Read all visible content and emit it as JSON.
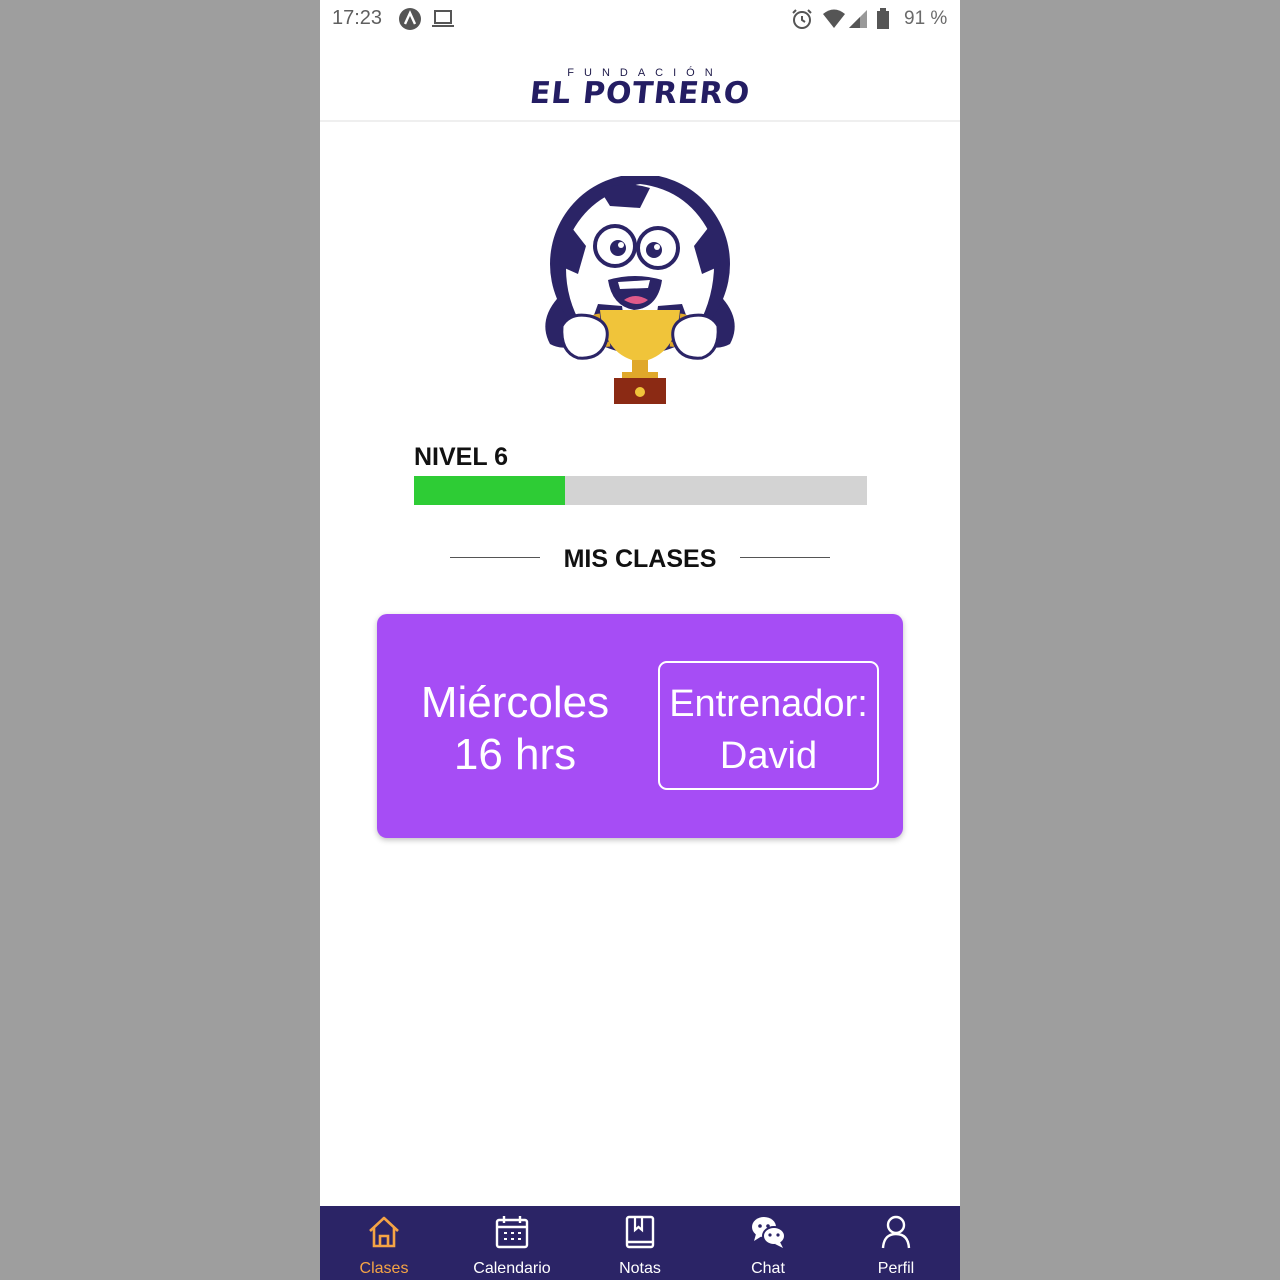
{
  "status_bar": {
    "time": "17:23",
    "battery_text": "91 %",
    "icons": [
      "app-notification-icon",
      "laptop-icon",
      "alarm-icon",
      "wifi-icon",
      "signal-icon",
      "battery-icon"
    ]
  },
  "header": {
    "brand_sub": "FUNDACIÓN",
    "brand_main": "EL POTRERO"
  },
  "mascot": {
    "icon": "soccer-ball-trophy-mascot"
  },
  "level": {
    "title": "NIVEL 6",
    "progress": 0.333,
    "fill_color": "#2ecc35",
    "track_color": "#d3d3d3"
  },
  "section": {
    "title": "MIS CLASES"
  },
  "class_card": {
    "day": "Miércoles",
    "time": "16 hrs",
    "coach_label": "Entrenador:",
    "coach_name": "David",
    "color": "#a64df5"
  },
  "bottom_nav": {
    "items": [
      {
        "label": "Clases",
        "icon": "home-icon",
        "active": true
      },
      {
        "label": "Calendario",
        "icon": "calendar-icon",
        "active": false
      },
      {
        "label": "Notas",
        "icon": "notebook-icon",
        "active": false
      },
      {
        "label": "Chat",
        "icon": "chat-icon",
        "active": false
      },
      {
        "label": "Perfil",
        "icon": "user-icon",
        "active": false
      }
    ],
    "background": "#2b2466",
    "active_color": "#f5a445"
  }
}
